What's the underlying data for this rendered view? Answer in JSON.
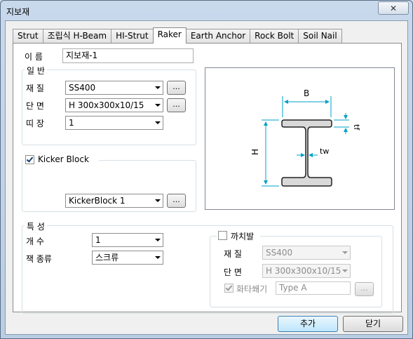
{
  "window": {
    "title": "지보재",
    "close_label": "✕"
  },
  "tabs": [
    {
      "label": "Strut",
      "active": false
    },
    {
      "label": "조립식 H-Beam",
      "active": false
    },
    {
      "label": "HI-Strut",
      "active": false
    },
    {
      "label": "Raker",
      "active": true
    },
    {
      "label": "Earth Anchor",
      "active": false
    },
    {
      "label": "Rock Bolt",
      "active": false
    },
    {
      "label": "Soil Nail",
      "active": false
    }
  ],
  "name": {
    "label": "이 름",
    "value": "지보재-1"
  },
  "general": {
    "title": "일 반",
    "material_label": "재 질",
    "material_value": "SS400",
    "section_label": "단 면",
    "section_value": "H 300x300x10/15",
    "tie_label": "띠 장",
    "tie_value": "1",
    "browse_label": "..."
  },
  "kicker": {
    "checked": true,
    "label": "Kicker Block",
    "value": "KickerBlock 1",
    "browse_label": "..."
  },
  "preview": {
    "dim_b": "B",
    "dim_h": "H",
    "dim_tw": "tw",
    "dim_tf": "tf",
    "line_color": "#00a0c8"
  },
  "properties": {
    "title": "특 성",
    "count_label": "개 수",
    "count_value": "1",
    "jack_label": "잭 종류",
    "jack_value": "스크류"
  },
  "bracket": {
    "checked": false,
    "label": "까치발",
    "material_label": "재 질",
    "material_value": "SS400",
    "section_label": "단 면",
    "section_value": "H 300x300x10/15",
    "wedge_checked": true,
    "wedge_label": "화타쐐기",
    "wedge_placeholder": "Type A",
    "browse_label": "..."
  },
  "footer": {
    "add_label": "추가",
    "close_label": "닫기"
  }
}
